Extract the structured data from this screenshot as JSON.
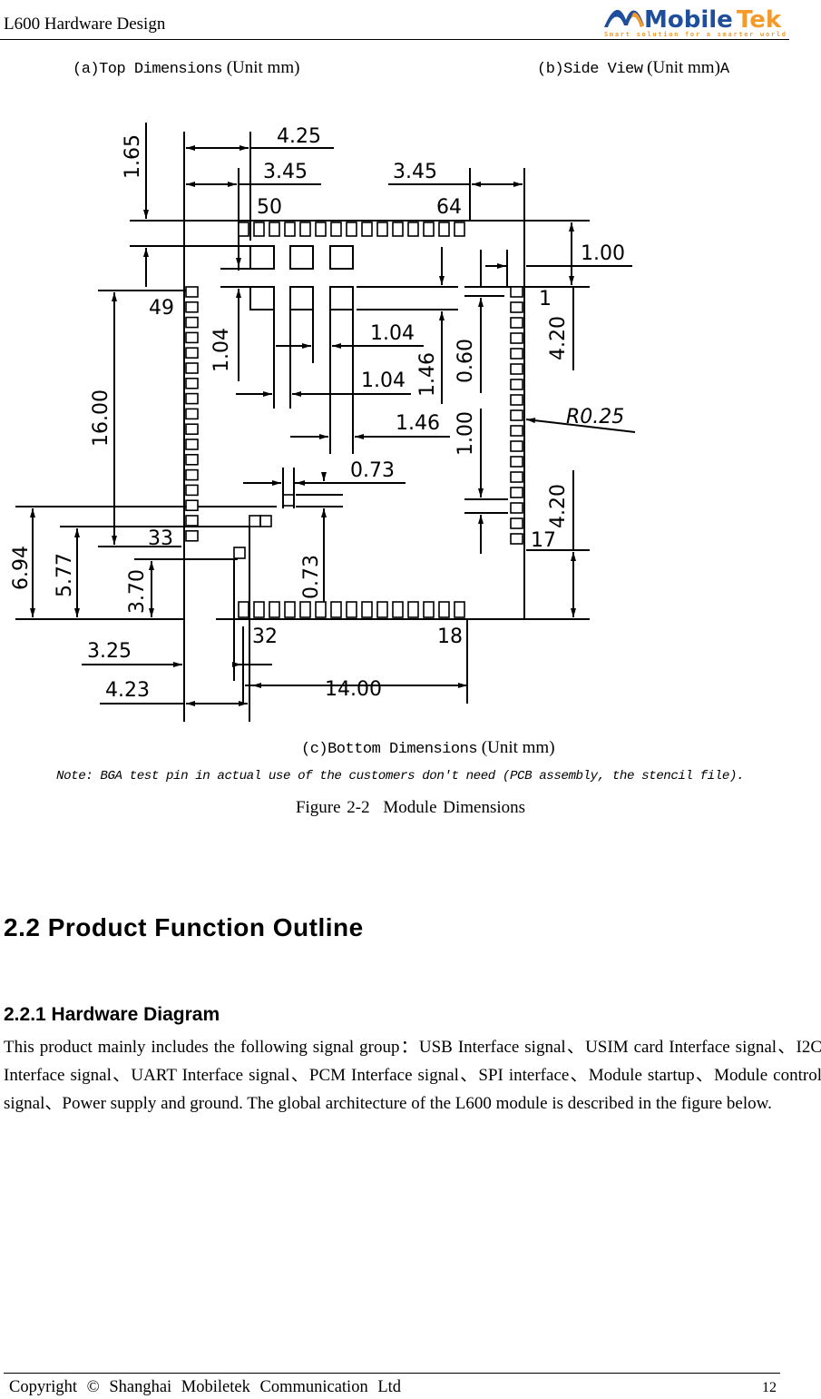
{
  "header": {
    "doc_title": "L600 Hardware Design",
    "logo": {
      "brand_main": "Mobile",
      "brand_accent": "Tek",
      "tagline": "Smart solution for a smarter world",
      "colors": {
        "blue": "#1f4e9c",
        "orange": "#f39a2b"
      }
    }
  },
  "figure": {
    "caption_a": {
      "label": "(a)Top Dimensions",
      "unit": "(Unit mm)"
    },
    "caption_b": {
      "label": "(b)Side View",
      "unit": "(Unit mm)",
      "suffix": "A"
    },
    "caption_c": {
      "label": "(c)Bottom Dimensions",
      "unit": "(Unit mm)"
    },
    "note": "Note: BGA test pin in actual use of the customers don't need (PCB assembly, the stencil file).",
    "title_num": "Figure 2-2",
    "title_text": "Module Dimensions",
    "dimensions": {
      "d_425": "4.25",
      "d_345_left": "3.45",
      "d_345_right": "3.45",
      "d_165": "1.65",
      "d_100_top": "1.00",
      "d_104_vert": "1.04",
      "d_104_h1": "1.04",
      "d_104_h2": "1.04",
      "d_146_vert": "1.46",
      "d_146_h": "1.46",
      "d_060": "0.60",
      "d_100_vert": "1.00",
      "d_073_h": "0.73",
      "d_073_vert": "0.73",
      "d_420_top": "4.20",
      "d_420_bot": "4.20",
      "d_r025": "R0.25",
      "d_1600": "16.00",
      "d_694": "6.94",
      "d_577": "5.77",
      "d_370": "3.70",
      "d_325": "3.25",
      "d_423": "4.23",
      "d_1400": "14.00"
    },
    "pins": {
      "p1": "1",
      "p17": "17",
      "p18": "18",
      "p32": "32",
      "p33": "33",
      "p49": "49",
      "p50": "50",
      "p64": "64"
    }
  },
  "section": {
    "h2": "2.2 Product Function Outline",
    "h3": "2.2.1 Hardware Diagram",
    "paragraph": "This product mainly includes the following signal group：USB Interface signal、USIM card Interface signal、I2C Interface signal、UART Interface signal、PCM Interface signal、SPI interface、Module startup、Module control signal、Power supply and ground. The global architecture of the L600 module is described in the figure below."
  },
  "footer": {
    "copyright": "Copyright © Shanghai Mobiletek Communication Ltd",
    "page_number": "12"
  }
}
